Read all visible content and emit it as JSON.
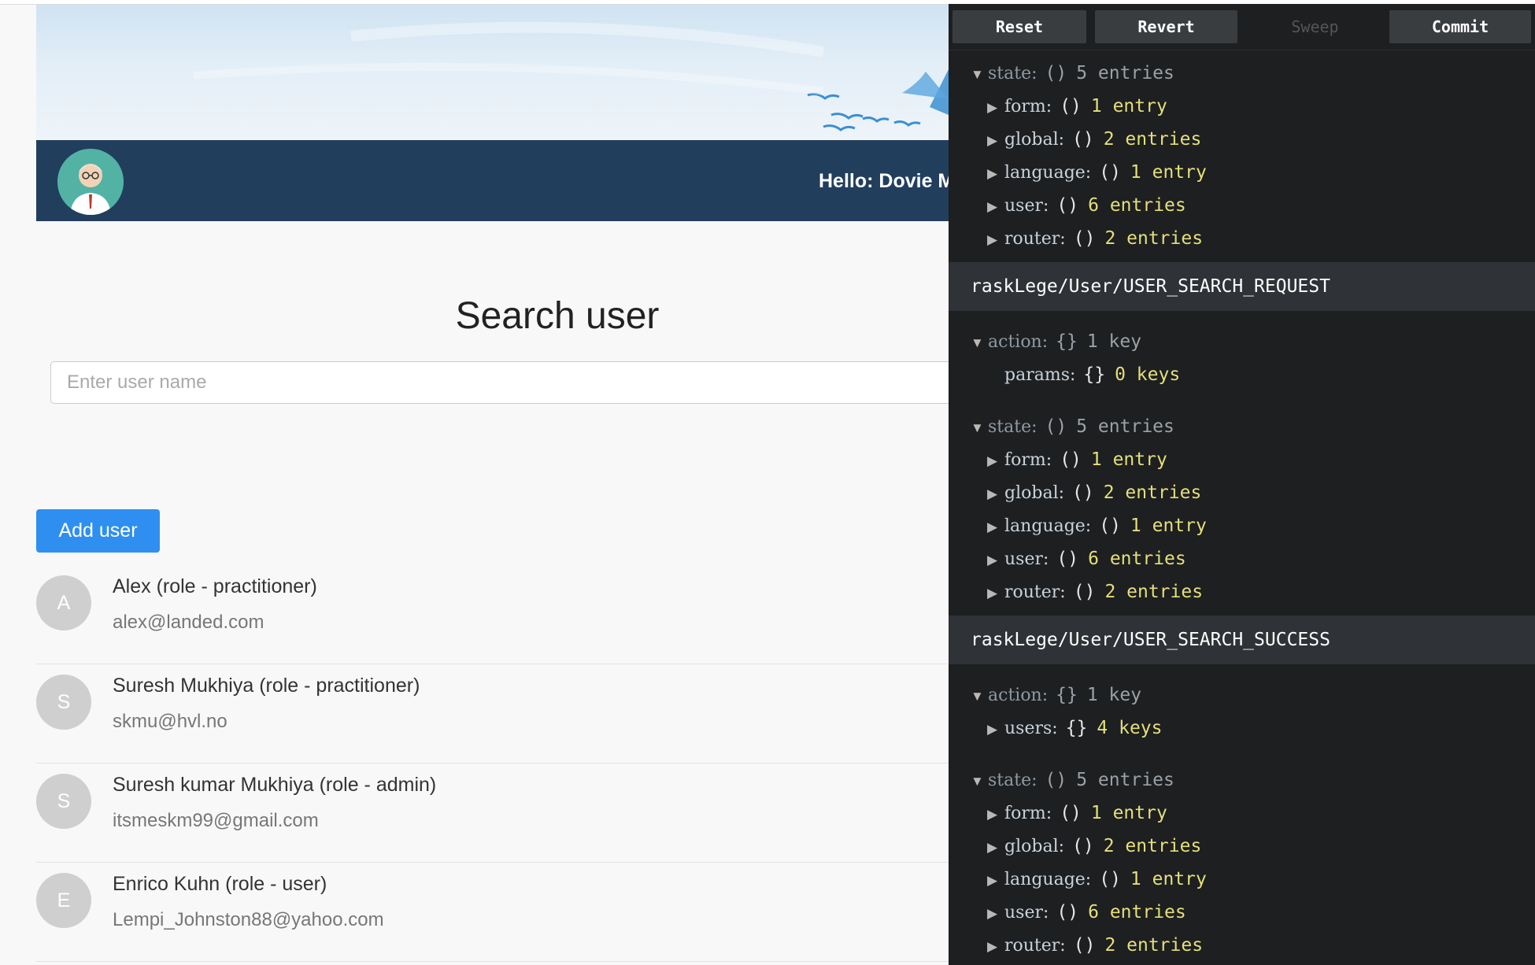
{
  "app": {
    "greeting": "Hello: Dovie M",
    "page_title": "Search user",
    "search": {
      "placeholder": "Enter user name",
      "value": ""
    },
    "add_user_label": "Add user",
    "users": [
      {
        "initial": "A",
        "name": "Alex (role - practitioner)",
        "email": "alex@landed.com"
      },
      {
        "initial": "S",
        "name": "Suresh Mukhiya (role - practitioner)",
        "email": "skmu@hvl.no"
      },
      {
        "initial": "S",
        "name": "Suresh kumar Mukhiya (role - admin)",
        "email": "itsmeskm99@gmail.com"
      },
      {
        "initial": "E",
        "name": "Enrico Kuhn (role - user)",
        "email": "Lempi_Johnston88@yahoo.com"
      }
    ]
  },
  "devtools": {
    "toolbar": {
      "reset": "Reset",
      "revert": "Revert",
      "sweep": "Sweep",
      "commit": "Commit"
    },
    "state_block_1": {
      "state": {
        "key": "state:",
        "brace": "()",
        "count": "5 entries"
      },
      "children": [
        {
          "key": "form:",
          "brace": "()",
          "count": "1 entry"
        },
        {
          "key": "global:",
          "brace": "()",
          "count": "2 entries"
        },
        {
          "key": "language:",
          "brace": "()",
          "count": "1 entry"
        },
        {
          "key": "user:",
          "brace": "()",
          "count": "6 entries"
        },
        {
          "key": "router:",
          "brace": "()",
          "count": "2 entries"
        }
      ]
    },
    "action_1": {
      "title": "raskLege/User/USER_SEARCH_REQUEST",
      "action": {
        "key": "action:",
        "brace": "{}",
        "count": "1 key"
      },
      "action_child": {
        "key": "params:",
        "brace": "{}",
        "count": "0 keys"
      },
      "state": {
        "key": "state:",
        "brace": "()",
        "count": "5 entries"
      },
      "children": [
        {
          "key": "form:",
          "brace": "()",
          "count": "1 entry"
        },
        {
          "key": "global:",
          "brace": "()",
          "count": "2 entries"
        },
        {
          "key": "language:",
          "brace": "()",
          "count": "1 entry"
        },
        {
          "key": "user:",
          "brace": "()",
          "count": "6 entries"
        },
        {
          "key": "router:",
          "brace": "()",
          "count": "2 entries"
        }
      ]
    },
    "action_2": {
      "title": "raskLege/User/USER_SEARCH_SUCCESS",
      "action": {
        "key": "action:",
        "brace": "{}",
        "count": "1 key"
      },
      "action_child": {
        "key": "users:",
        "brace": "{}",
        "count": "4 keys"
      },
      "state": {
        "key": "state:",
        "brace": "()",
        "count": "5 entries"
      },
      "children": [
        {
          "key": "form:",
          "brace": "()",
          "count": "1 entry"
        },
        {
          "key": "global:",
          "brace": "()",
          "count": "2 entries"
        },
        {
          "key": "language:",
          "brace": "()",
          "count": "1 entry"
        },
        {
          "key": "user:",
          "brace": "()",
          "count": "6 entries"
        },
        {
          "key": "router:",
          "brace": "()",
          "count": "2 entries"
        }
      ]
    }
  }
}
